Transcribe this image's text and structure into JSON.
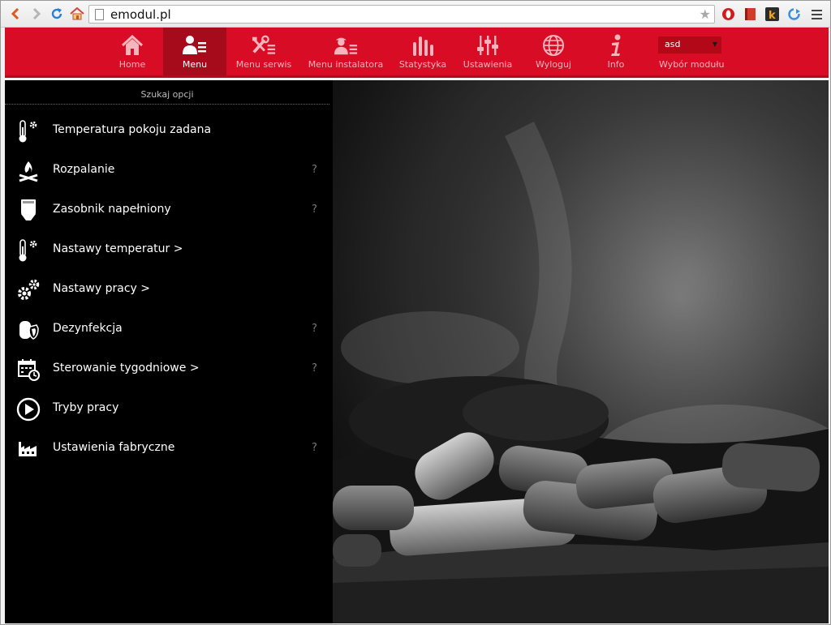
{
  "browser": {
    "url": "emodul.pl",
    "icons": [
      "back-icon",
      "forward-icon",
      "reload-icon",
      "home-icon",
      "page-icon",
      "bookmark-star-icon",
      "opera-extension-icon",
      "red-book-extension-icon",
      "k-extension-icon",
      "sync-extension-icon",
      "hamburger-menu-icon"
    ]
  },
  "topnav": {
    "items": [
      {
        "label": "Home",
        "icon": "house-icon"
      },
      {
        "label": "Menu",
        "icon": "user-menu-icon",
        "active": true
      },
      {
        "label": "Menu serwis",
        "icon": "tools-menu-icon"
      },
      {
        "label": "Menu instalatora",
        "icon": "installer-menu-icon"
      },
      {
        "label": "Statystyka",
        "icon": "bar-chart-icon"
      },
      {
        "label": "Ustawienia",
        "icon": "sliders-icon"
      },
      {
        "label": "Wyloguj",
        "icon": "globe-icon"
      },
      {
        "label": "Info",
        "icon": "info-icon"
      }
    ],
    "module_select_value": "asd",
    "module_label": "Wybór modułu"
  },
  "sidebar": {
    "search_label": "Szukaj opcji",
    "items": [
      {
        "label": "Temperatura pokoju zadana",
        "icon": "thermometer-gear-icon",
        "help": ""
      },
      {
        "label": "Rozpalanie",
        "icon": "campfire-icon",
        "help": "?"
      },
      {
        "label": "Zasobnik napełniony",
        "icon": "hopper-icon",
        "help": "?"
      },
      {
        "label": "Nastawy temperatur >",
        "icon": "thermometer-gear-icon",
        "help": ""
      },
      {
        "label": "Nastawy pracy >",
        "icon": "gears-icon",
        "help": ""
      },
      {
        "label": "Dezynfekcja",
        "icon": "tank-shield-icon",
        "help": "?"
      },
      {
        "label": "Sterowanie tygodniowe >",
        "icon": "calendar-clock-icon",
        "help": "?"
      },
      {
        "label": "Tryby pracy",
        "icon": "play-circle-icon",
        "help": ""
      },
      {
        "label": "Ustawienia fabryczne",
        "icon": "factory-icon",
        "help": "?"
      }
    ]
  },
  "colors": {
    "brand_red": "#d80d25",
    "active_red": "#a60b1c",
    "sidebar_bg": "#000000"
  }
}
